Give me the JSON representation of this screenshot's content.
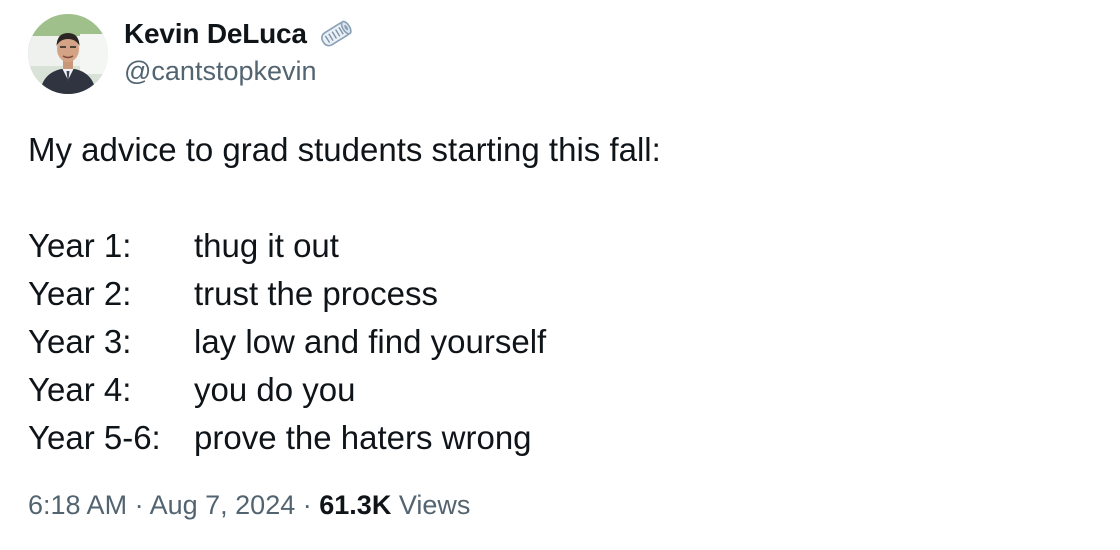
{
  "author": {
    "display_name": "Kevin DeLuca",
    "handle": "@cantstopkevin",
    "avatar_icon": "profile-photo",
    "badge_icon": "rolled-newspaper-icon"
  },
  "tweet": {
    "intro": "My advice to grad students starting this fall:",
    "advice": [
      {
        "year": "Year 1:",
        "text": "thug it out"
      },
      {
        "year": "Year 2:",
        "text": "trust the process"
      },
      {
        "year": "Year 3:",
        "text": "lay low and find yourself"
      },
      {
        "year": "Year 4:",
        "text": "you do you"
      },
      {
        "year": "Year 5-6:",
        "text": "prove the haters wrong"
      }
    ]
  },
  "meta": {
    "time": "6:18 AM",
    "separator": "·",
    "date": "Aug 7, 2024",
    "views_count": "61.3K",
    "views_label": "Views"
  },
  "colors": {
    "text": "#0f1419",
    "secondary": "#536471",
    "background": "#ffffff"
  }
}
